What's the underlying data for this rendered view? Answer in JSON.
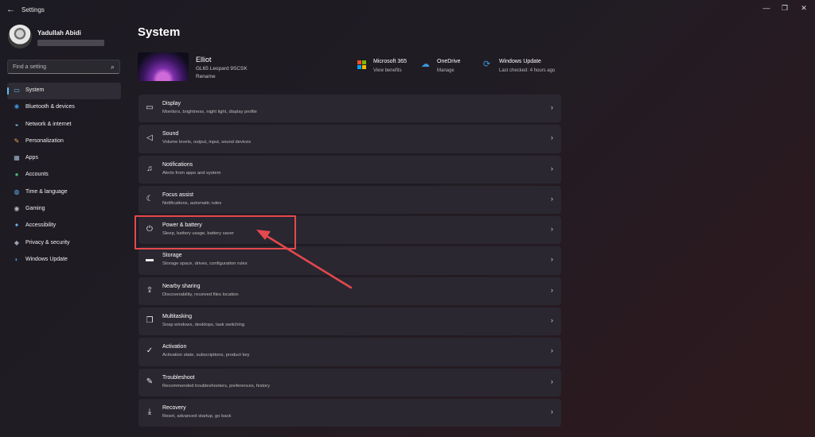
{
  "window": {
    "title": "Settings",
    "back_glyph": "←",
    "minimize_glyph": "—",
    "maximize_glyph": "❐",
    "close_glyph": "✕"
  },
  "profile": {
    "name": "Yadullah Abidi"
  },
  "search": {
    "placeholder": "Find a setting",
    "icon_glyph": "⌕"
  },
  "sidebar": {
    "items": [
      {
        "label": "System",
        "icon": "monitor-icon",
        "glyph": "▭",
        "color": "#5cc3f5",
        "active": true
      },
      {
        "label": "Bluetooth & devices",
        "icon": "bluetooth-icon",
        "glyph": "✱",
        "color": "#3a96dd"
      },
      {
        "label": "Network & internet",
        "icon": "wifi-icon",
        "glyph": "◒",
        "color": "#7ac7f0"
      },
      {
        "label": "Personalization",
        "icon": "brush-icon",
        "glyph": "✎",
        "color": "#e8a95c"
      },
      {
        "label": "Apps",
        "icon": "apps-icon",
        "glyph": "▦",
        "color": "#9fb4c8"
      },
      {
        "label": "Accounts",
        "icon": "person-icon",
        "glyph": "●",
        "color": "#4ab86f"
      },
      {
        "label": "Time & language",
        "icon": "globe-icon",
        "glyph": "◍",
        "color": "#5cb3f0"
      },
      {
        "label": "Gaming",
        "icon": "gamepad-icon",
        "glyph": "◉",
        "color": "#b8b8b8"
      },
      {
        "label": "Accessibility",
        "icon": "accessibility-icon",
        "glyph": "✦",
        "color": "#6cb8f5"
      },
      {
        "label": "Privacy & security",
        "icon": "shield-icon",
        "glyph": "◆",
        "color": "#9aa3ad"
      },
      {
        "label": "Windows Update",
        "icon": "update-icon",
        "glyph": "◐",
        "color": "#3a96dd"
      }
    ]
  },
  "main": {
    "title": "System",
    "device": {
      "name": "Elliot",
      "model": "GL65 Leopard 9SCSK",
      "rename_label": "Rename"
    },
    "quick_links": [
      {
        "title": "Microsoft 365",
        "subtitle": "View benefits",
        "icon": "microsoft-logo-icon"
      },
      {
        "title": "OneDrive",
        "subtitle": "Manage",
        "icon": "onedrive-cloud-icon",
        "glyph": "☁"
      },
      {
        "title": "Windows Update",
        "subtitle": "Last checked: 4 hours ago",
        "icon": "windows-update-icon",
        "glyph": "⟳"
      }
    ],
    "chevron_glyph": "›",
    "settings": [
      {
        "title": "Display",
        "subtitle": "Monitors, brightness, night light, display profile",
        "icon": "display-icon",
        "glyph": "▭"
      },
      {
        "title": "Sound",
        "subtitle": "Volume levels, output, input, sound devices",
        "icon": "speaker-icon",
        "glyph": "◁"
      },
      {
        "title": "Notifications",
        "subtitle": "Alerts from apps and system",
        "icon": "bell-icon",
        "glyph": "♫"
      },
      {
        "title": "Focus assist",
        "subtitle": "Notifications, automatic rules",
        "icon": "moon-icon",
        "glyph": "☾"
      },
      {
        "title": "Power & battery",
        "subtitle": "Sleep, battery usage, battery saver",
        "icon": "power-icon",
        "glyph": "⏻"
      },
      {
        "title": "Storage",
        "subtitle": "Storage space, drives, configuration rules",
        "icon": "storage-icon",
        "glyph": "▬"
      },
      {
        "title": "Nearby sharing",
        "subtitle": "Discoverability, received files location",
        "icon": "share-icon",
        "glyph": "⇪"
      },
      {
        "title": "Multitasking",
        "subtitle": "Snap windows, desktops, task switching",
        "icon": "multitask-icon",
        "glyph": "❐"
      },
      {
        "title": "Activation",
        "subtitle": "Activation state, subscriptions, product key",
        "icon": "checkmark-circle-icon",
        "glyph": "✓"
      },
      {
        "title": "Troubleshoot",
        "subtitle": "Recommended troubleshooters, preferences, history",
        "icon": "wrench-icon",
        "glyph": "✎"
      },
      {
        "title": "Recovery",
        "subtitle": "Reset, advanced startup, go back",
        "icon": "recovery-icon",
        "glyph": "⤓"
      }
    ]
  },
  "annotation": {
    "highlight_color": "#e5484d"
  }
}
